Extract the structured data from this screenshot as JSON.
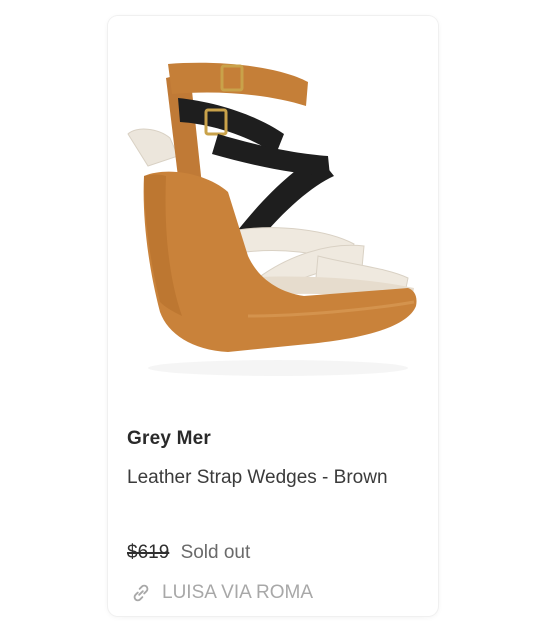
{
  "product": {
    "image_alt": "Leather Strap Wedges - Brown",
    "brand": "Grey Mer",
    "title": "Leather Strap Wedges - Brown",
    "price": "$619",
    "status": "Sold out",
    "retailer": "LUISA VIA ROMA",
    "icons": {
      "retailer_link": "link-icon"
    }
  },
  "colors": {
    "brand_text": "#2a2a2a",
    "body_text": "#3b3b3b",
    "muted_text": "#a8a8a8",
    "wedge": "#c9823a",
    "strap_black": "#1c1c1c",
    "strap_cream": "#efe9df"
  }
}
